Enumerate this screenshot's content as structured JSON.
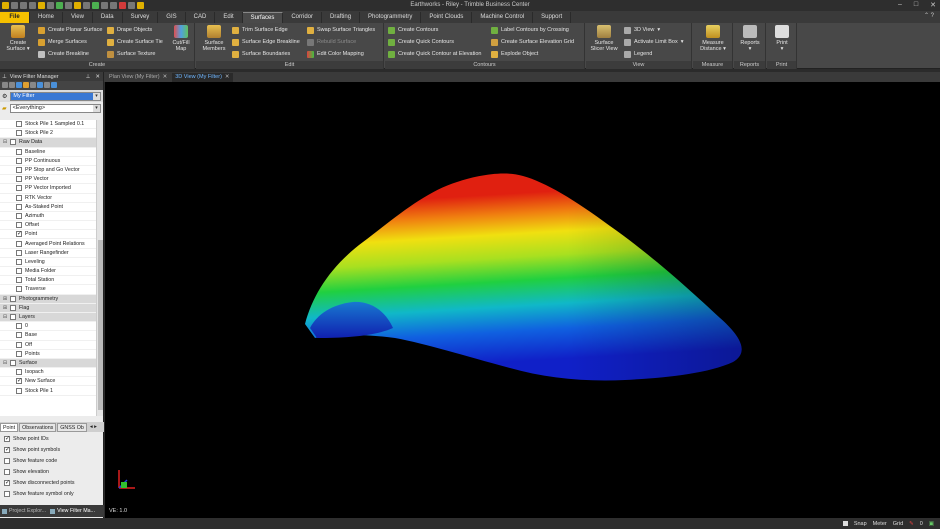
{
  "window": {
    "title": "Earthworks - Riley - Trimble Business Center"
  },
  "ribbon_tabs": [
    "File",
    "Home",
    "View",
    "Data",
    "Survey",
    "GIS",
    "CAD",
    "Edit",
    "Surfaces",
    "Corridor",
    "Drafting",
    "Photogrammetry",
    "Point Clouds",
    "Machine Control",
    "Support"
  ],
  "active_tab": "Surfaces",
  "ribbon": {
    "create": {
      "label": "Create",
      "create_surface": "Create Surface",
      "create_planar_surface": "Create Planar Surface",
      "merge_surfaces": "Merge Surfaces",
      "create_breakline": "Create Breakline",
      "drape_objects": "Drape Objects",
      "create_surface_tie": "Create Surface Tie",
      "surface_texture": "Surface Texture",
      "cut_fill_map": "Cut/Fill Map"
    },
    "edit": {
      "label": "Edit",
      "surface_members": "Surface Members",
      "trim_surface_edge": "Trim Surface Edge",
      "surface_edge_breakline": "Surface Edge Breakline",
      "surface_boundaries": "Surface Boundaries",
      "swap_surface_triangles": "Swap Surface Triangles",
      "rebuild_surface": "Rebuild Surface",
      "edit_color_mapping": "Edit Color Mapping"
    },
    "contours": {
      "label": "Contours",
      "create_contours": "Create Contours",
      "create_quick_contours": "Create Quick Contours",
      "create_quick_contour_at_elevation": "Create Quick Contour at Elevation",
      "label_contours_by_crossing": "Label Contours by Crossing",
      "create_surface_elevation_grid": "Create Surface Elevation Grid",
      "explode_object": "Explode Object"
    },
    "view": {
      "label": "View",
      "surface_slicer_view": "Surface Slicer View",
      "three_d_view": "3D View",
      "activate_limit_box": "Activate Limit Box",
      "legend": "Legend"
    },
    "measure": {
      "label": "Measure",
      "measure_distance": "Measure Distance"
    },
    "reports": {
      "label": "Reports",
      "reports": "Reports"
    },
    "print": {
      "label": "Print",
      "print": "Print"
    }
  },
  "doc_tabs": [
    {
      "label": "Plan View (My Filter)",
      "active": false
    },
    {
      "label": "3D View (My Filter)",
      "active": true
    }
  ],
  "panel": {
    "title": "View Filter Manager",
    "filter": "My Filter",
    "everything": "<Everything>",
    "tree": [
      {
        "label": "Stock Pile 1 Sampled 0.1",
        "level": 1,
        "checked": false
      },
      {
        "label": "Stock Pile 2",
        "level": 1,
        "checked": false
      },
      {
        "label": "Raw Data",
        "level": 0,
        "group": true,
        "expander": "⊟",
        "checked": false
      },
      {
        "label": "Baseline",
        "level": 1,
        "checked": false
      },
      {
        "label": "PP Continuous",
        "level": 1,
        "checked": false
      },
      {
        "label": "PP Stop and Go Vector",
        "level": 1,
        "checked": false
      },
      {
        "label": "PP Vector",
        "level": 1,
        "checked": false
      },
      {
        "label": "PP Vector Imported",
        "level": 1,
        "checked": false
      },
      {
        "label": "RTK Vector",
        "level": 1,
        "checked": false
      },
      {
        "label": "As-Staked Point",
        "level": 1,
        "checked": false
      },
      {
        "label": "Azimuth",
        "level": 1,
        "checked": false
      },
      {
        "label": "Offset",
        "level": 1,
        "checked": false
      },
      {
        "label": "Point",
        "level": 1,
        "checked": true
      },
      {
        "label": "Averaged Point Relations",
        "level": 1,
        "checked": false
      },
      {
        "label": "Laser Rangefinder",
        "level": 1,
        "checked": false
      },
      {
        "label": "Leveling",
        "level": 1,
        "checked": false
      },
      {
        "label": "Media Folder",
        "level": 1,
        "checked": false
      },
      {
        "label": "Total Station",
        "level": 1,
        "checked": false
      },
      {
        "label": "Traverse",
        "level": 1,
        "checked": false
      },
      {
        "label": "Photogrammetry",
        "level": 0,
        "group": true,
        "expander": "⊞",
        "checked": false
      },
      {
        "label": "Flag",
        "level": 0,
        "group": true,
        "expander": "⊞",
        "checked": false
      },
      {
        "label": "Layers",
        "level": 0,
        "group": true,
        "expander": "⊟",
        "checked": false
      },
      {
        "label": "0",
        "level": 1,
        "checked": false
      },
      {
        "label": "Base",
        "level": 1,
        "checked": false
      },
      {
        "label": "Off",
        "level": 1,
        "checked": false
      },
      {
        "label": "Points",
        "level": 1,
        "checked": false
      },
      {
        "label": "Surface",
        "level": 0,
        "group": true,
        "expander": "⊟",
        "checked": false
      },
      {
        "label": "Isopach",
        "level": 1,
        "checked": false
      },
      {
        "label": "New Surface",
        "level": 1,
        "checked": true
      },
      {
        "label": "Stock Pile 1",
        "level": 1,
        "checked": false
      }
    ],
    "sub_tabs": [
      "Point",
      "Observations",
      "GNSS Ob"
    ],
    "options": [
      {
        "label": "Show point IDs",
        "checked": true
      },
      {
        "label": "Show point symbols",
        "checked": true
      },
      {
        "label": "Show feature code",
        "checked": false
      },
      {
        "label": "Show elevation",
        "checked": false
      },
      {
        "label": "Show disconnected points",
        "checked": true
      },
      {
        "label": "Show feature symbol only",
        "checked": false
      }
    ],
    "bottom_tabs": [
      "Project Explor...",
      "View Filter Ma..."
    ]
  },
  "viewport": {
    "ve": "VE: 1.0"
  },
  "status": {
    "snap": "Snap",
    "units": "Meter",
    "grid": "Grid",
    "count": "0"
  },
  "colors": {
    "accent": "#f5c000",
    "viewport_bg": "#000000"
  }
}
